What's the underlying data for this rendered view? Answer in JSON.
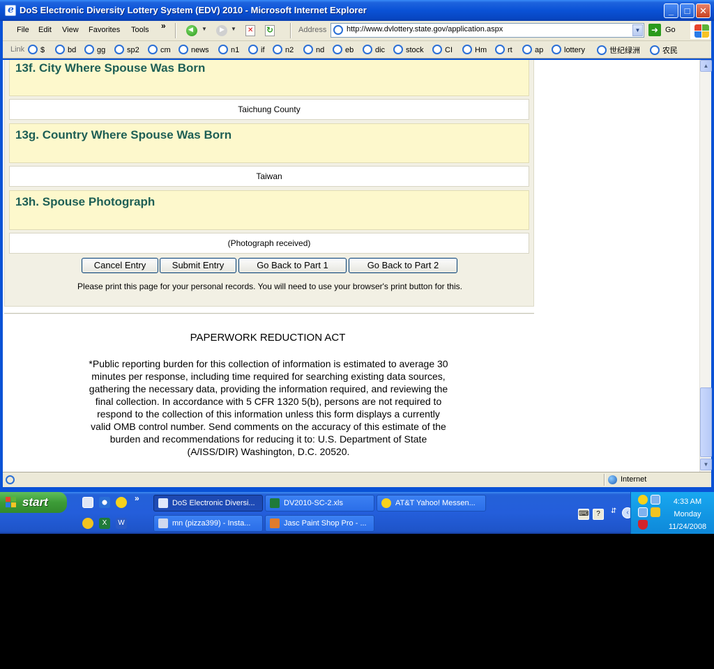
{
  "window": {
    "title": "DoS Electronic Diversity Lottery System (EDV) 2010 - Microsoft Internet Explorer",
    "min_glyph": "_",
    "max_glyph": "□",
    "close_glyph": "✕"
  },
  "menu": {
    "items": [
      "File",
      "Edit",
      "View",
      "Favorites",
      "Tools"
    ],
    "more": "»",
    "address_label": "Address",
    "url": "http://www.dvlottery.state.gov/application.aspx",
    "go_label": "Go"
  },
  "links": {
    "label": "Link",
    "items": [
      "$",
      "bd",
      "gg",
      "sp2",
      "cm",
      "news",
      "n1",
      "if",
      "n2",
      "nd",
      "eb",
      "dic",
      "stock",
      "CI",
      "Hm",
      "rt",
      "ap",
      "lottery",
      "世纪绿洲",
      "农民"
    ]
  },
  "form": {
    "q13f": "13f. City Where Spouse Was Born",
    "a13f": "Taichung County",
    "q13g": "13g. Country Where Spouse Was Born",
    "a13g": "Taiwan",
    "q13h": "13h. Spouse Photograph",
    "a13h": "(Photograph received)",
    "buttons": {
      "cancel": "Cancel Entry",
      "submit": "Submit Entry",
      "back1": "Go Back to Part 1",
      "back2": "Go Back to Part 2"
    },
    "print_note": "Please print this page for your personal records. You will need to use your browser's print button for this."
  },
  "pra": {
    "title": "PAPERWORK REDUCTION ACT",
    "text": "*Public reporting burden for this collection of information is estimated to average 30 minutes per response, including time required for searching existing data sources, gathering the necessary data, providing the information required, and reviewing the final collection. In accordance with 5 CFR 1320 5(b), persons are not required to respond to the collection of this information unless this form displays a currently valid OMB control number. Send comments on the accuracy of this estimate of the burden and recommendations for reducing it to: U.S. Department of State (A/ISS/DIR) Washington, D.C. 20520."
  },
  "status": {
    "zone": "Internet"
  },
  "taskbar": {
    "start": "start",
    "more": "»",
    "tasks": [
      "DoS Electronic Diversi...",
      "DV2010-SC-2.xls",
      "AT&T Yahoo! Messen...",
      "mn (pizza399) - Insta...",
      "Jasc Paint Shop Pro - ..."
    ],
    "clock": {
      "time": "4:33 AM",
      "day": "Monday",
      "date": "11/24/2008"
    }
  },
  "colors": {
    "title_blue": "#0a52d6",
    "question_bg": "#fdf8cc",
    "question_text": "#1e5f55",
    "taskbar_blue": "#245edb",
    "start_green": "#3c9b37"
  }
}
